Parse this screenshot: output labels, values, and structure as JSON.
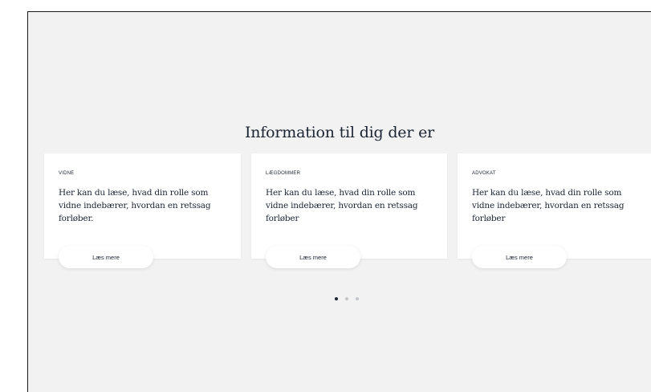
{
  "section": {
    "title": "Information til dig der er"
  },
  "cards": [
    {
      "kicker": "VIDNE",
      "text": "Her kan du læse, hvad din rolle som vidne indebærer, hvordan en retssag forløber.",
      "button_label": "Læs mere"
    },
    {
      "kicker": "LÆGDOMMER",
      "text": "Her kan du læse, hvad din rolle som vidne indebærer, hvordan en retssag forløber",
      "button_label": "Læs mere"
    },
    {
      "kicker": "ADVOKAT",
      "text": "Her kan du læse, hvad din rolle som vidne indebærer, hvordan en retssag forløber",
      "button_label": "Læs mere"
    }
  ],
  "carousel": {
    "total_pages": 3,
    "active_page": 1
  },
  "colors": {
    "background": "#f2f2f2",
    "text": "#1b2433",
    "card": "#ffffff",
    "dot_inactive": "#c2c5ca"
  }
}
